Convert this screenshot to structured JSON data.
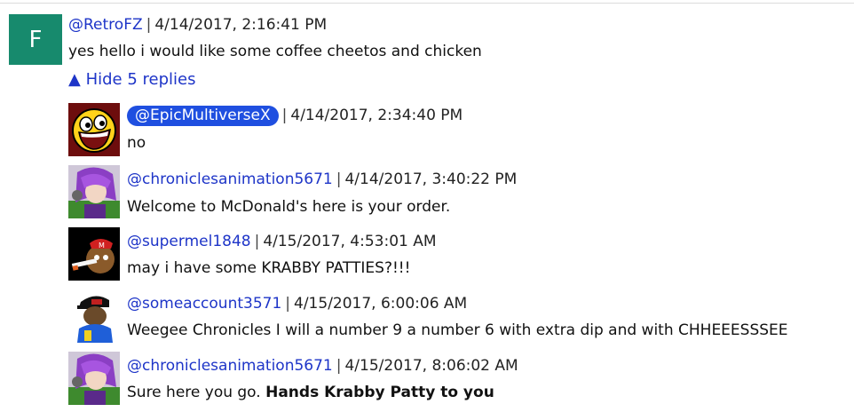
{
  "colors": {
    "link": "#1e35c8",
    "badge": "#1f4fe0",
    "letter_avatar": "#178a6d"
  },
  "comment": {
    "avatar_letter": "F",
    "user": "@RetroFZ",
    "separator": "|",
    "time": "4/14/2017, 2:16:41 PM",
    "text": "yes hello i would like some coffee cheetos and chicken",
    "toggle_arrow": "▲",
    "toggle_label": "Hide 5 replies"
  },
  "replies": [
    {
      "user": "@EpicMultiverseX",
      "separator": "|",
      "time": "4/14/2017, 2:34:40 PM",
      "text": "no",
      "avatar_icon": "awesome-face-icon"
    },
    {
      "user": "@chroniclesanimation5671",
      "separator": "|",
      "time": "4/14/2017, 3:40:22 PM",
      "text": "Welcome to McDonald's here is your order.",
      "avatar_icon": "purple-character-icon"
    },
    {
      "user": "@supermel1848",
      "separator": "|",
      "time": "4/15/2017, 4:53:01 AM",
      "text": "may i have some KRABBY PATTIES?!!!",
      "avatar_icon": "cartoon-smoker-icon"
    },
    {
      "user": "@someaccount3571",
      "separator": "|",
      "time": "4/15/2017, 6:00:06 AM",
      "text": "Weegee Chronicles I will a number 9 a number 6 with extra dip and with CHHEEESSSEE",
      "avatar_icon": "cap-character-icon"
    },
    {
      "user": "@chroniclesanimation5671",
      "separator": "|",
      "time": "4/15/2017, 8:06:02 AM",
      "text_plain": "Sure here you go. ",
      "text_bold": "Hands Krabby Patty to you",
      "avatar_icon": "purple-character-icon"
    }
  ]
}
